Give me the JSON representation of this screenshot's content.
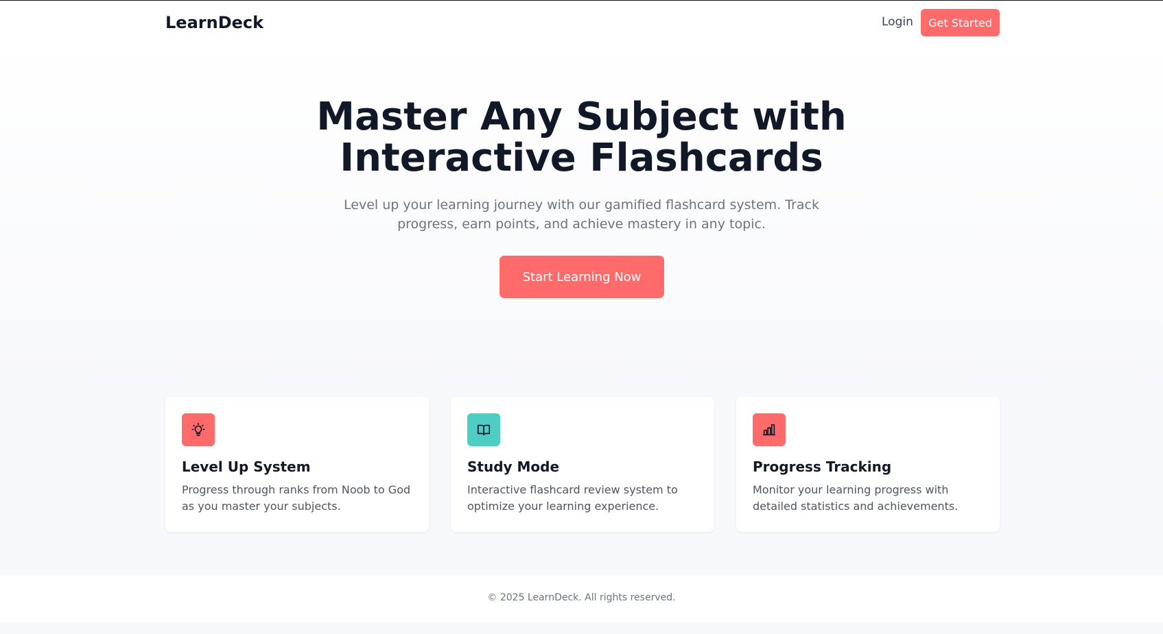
{
  "header": {
    "logo": "LearnDeck",
    "login_label": "Login",
    "get_started_label": "Get Started"
  },
  "hero": {
    "title": "Master Any Subject with Interactive Flashcards",
    "subtitle": "Level up your learning journey with our gamified flashcard system. Track progress, earn points, and achieve mastery in any topic.",
    "cta_label": "Start Learning Now"
  },
  "features": [
    {
      "icon": "lightbulb-icon",
      "color": "#ff6b6b",
      "title": "Level Up System",
      "description": "Progress through ranks from Noob to God as you master your subjects."
    },
    {
      "icon": "book-icon",
      "color": "#4ecdc4",
      "title": "Study Mode",
      "description": "Interactive flashcard review system to optimize your learning experience."
    },
    {
      "icon": "bar-chart-icon",
      "color": "#ff6b6b",
      "title": "Progress Tracking",
      "description": "Monitor your learning progress with detailed statistics and achievements."
    }
  ],
  "footer": {
    "copyright": "© 2025 LearnDeck. All rights reserved."
  },
  "colors": {
    "accent": "#ff6b6b",
    "teal": "#4ecdc4",
    "text_dark": "#111827",
    "text_muted": "#6b7280"
  }
}
